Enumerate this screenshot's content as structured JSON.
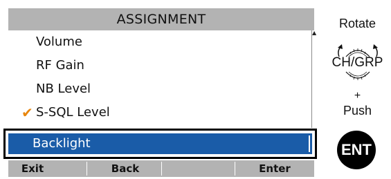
{
  "screen": {
    "title": "ASSIGNMENT",
    "items": [
      {
        "label": "Volume",
        "checked": false
      },
      {
        "label": "RF Gain",
        "checked": false
      },
      {
        "label": "NB Level",
        "checked": false
      },
      {
        "label": "S-SQL Level",
        "checked": true
      },
      {
        "label": "Backlight",
        "checked": false,
        "selected": true
      }
    ],
    "check_mark": "✔",
    "softkeys": [
      "Exit",
      "Back",
      "",
      "Enter"
    ]
  },
  "hint": {
    "rotate": "Rotate",
    "dial_label": "CH/GRP",
    "plus": "+",
    "push": "Push",
    "ent_label": "ENT"
  },
  "colors": {
    "title_bar": "#b3b3b3",
    "selection": "#1a5ca8",
    "check": "#e8860d"
  }
}
